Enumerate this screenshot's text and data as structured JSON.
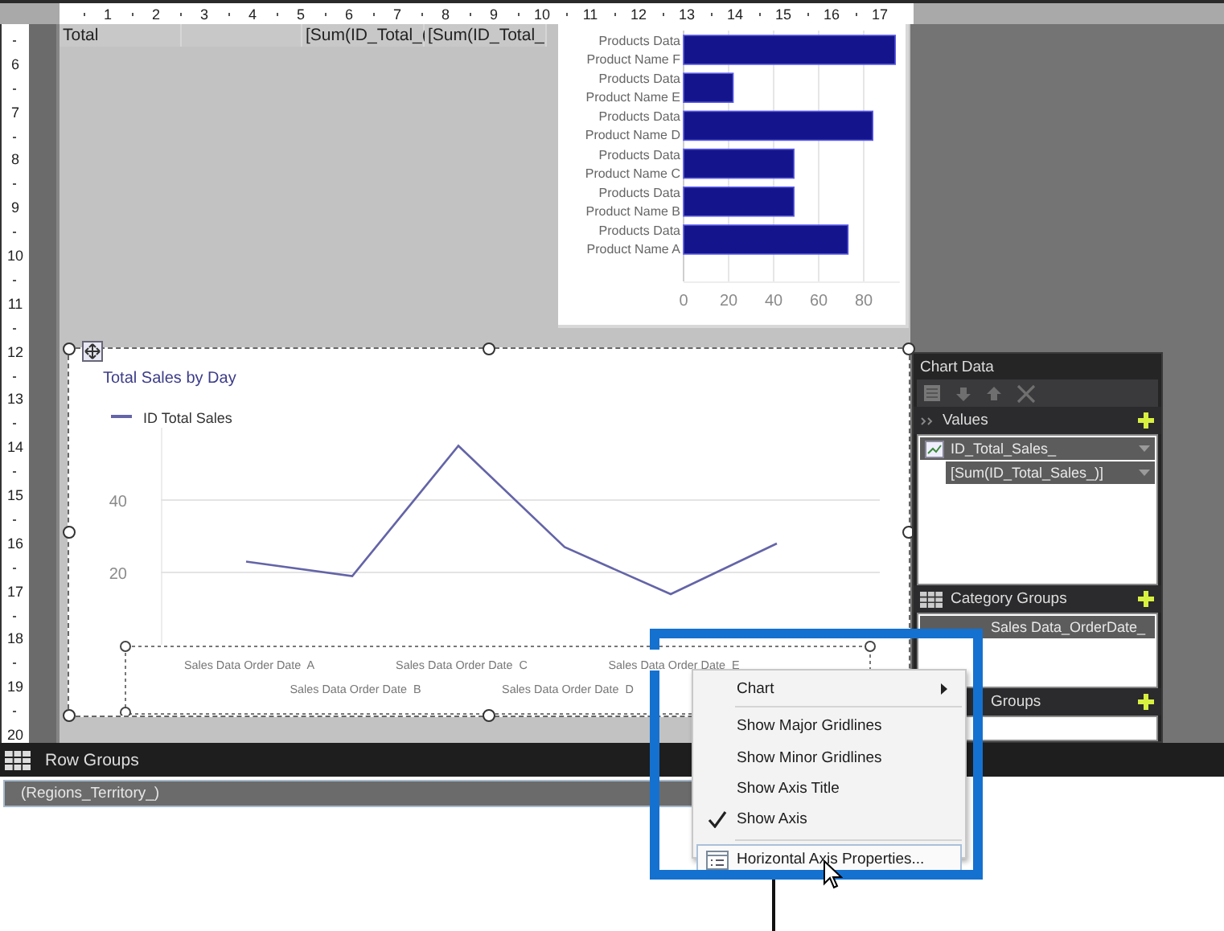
{
  "rulers": {
    "horizontal": [
      "1",
      "2",
      "3",
      "4",
      "5",
      "6",
      "7",
      "8",
      "9",
      "10",
      "11",
      "12",
      "13",
      "14",
      "15",
      "16",
      "17"
    ],
    "vertical": [
      "6",
      "7",
      "8",
      "9",
      "10",
      "11",
      "12",
      "13",
      "14",
      "15",
      "16",
      "17",
      "18",
      "19",
      "20"
    ]
  },
  "table_row": {
    "cells": [
      "Total",
      "[Sum(ID_Total_(",
      "[Sum(ID_Total_"
    ]
  },
  "bar_chart": {
    "chart_data": {
      "type": "bar",
      "orientation": "horizontal",
      "categories": [
        "Products Data\nProduct Name  F",
        "Products Data\nProduct Name  E",
        "Products Data\nProduct Name  D",
        "Products Data\nProduct Name  C",
        "Products Data\nProduct Name  B",
        "Products Data\nProduct Name  A"
      ],
      "values": [
        94,
        22,
        84,
        49,
        49,
        73
      ],
      "xticks": [
        0,
        20,
        40,
        60,
        80
      ],
      "xlim": [
        0,
        96
      ],
      "grid": true
    }
  },
  "line_chart": {
    "selected": true,
    "axis_selected": true,
    "chart_data": {
      "type": "line",
      "title": "Total Sales by Day",
      "categories": [
        "Sales Data Order Date  A",
        "Sales Data Order Date  B",
        "Sales Data Order Date  C",
        "Sales Data Order Date  D",
        "Sales Data Order Date  E",
        null
      ],
      "series": [
        {
          "name": "ID Total Sales",
          "color": "#6464a8",
          "values": [
            23,
            19,
            55,
            27,
            14,
            28
          ]
        }
      ],
      "yticks": [
        20,
        40
      ],
      "ylim": [
        0,
        60
      ],
      "grid": true
    }
  },
  "chart_data_panel": {
    "title": "Chart Data",
    "sections": [
      {
        "kind": "values",
        "title": "Values",
        "items": [
          {
            "label": "ID_Total_Sales_",
            "children": [
              {
                "label": "[Sum(ID_Total_Sales_)]"
              }
            ]
          }
        ]
      },
      {
        "kind": "category",
        "title": "Category Groups",
        "items": [
          {
            "label": "Sales Data_OrderDate_"
          }
        ]
      },
      {
        "kind": "series",
        "title": "Groups"
      }
    ]
  },
  "context_menu": {
    "items": [
      {
        "kind": "submenu",
        "label": "Chart",
        "highlighted": false
      },
      {
        "kind": "separator"
      },
      {
        "kind": "option",
        "label": "Show Major Gridlines",
        "checked": false,
        "highlighted": false
      },
      {
        "kind": "option",
        "label": "Show Minor Gridlines",
        "checked": false,
        "highlighted": false
      },
      {
        "kind": "option",
        "label": "Show Axis Title",
        "checked": false,
        "highlighted": false
      },
      {
        "kind": "option",
        "label": "Show Axis",
        "checked": true,
        "highlighted": false
      },
      {
        "kind": "separator"
      },
      {
        "kind": "command",
        "label": "Horizontal Axis Properties...",
        "highlighted": true
      }
    ]
  },
  "row_groups": {
    "title": "Row Groups",
    "items": [
      {
        "label": "(Regions_Territory_)",
        "selected": true
      }
    ]
  }
}
